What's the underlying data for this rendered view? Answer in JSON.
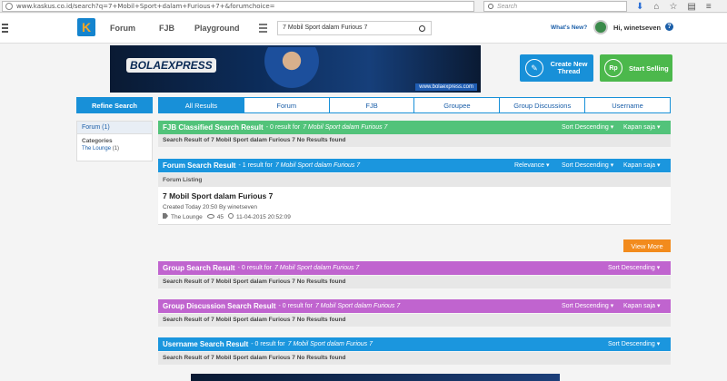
{
  "browser": {
    "url": "www.kaskus.co.id/search?q=7+Mobil+Sport+dalam+Furious+7+&forumchoice=",
    "search_placeholder": "Search"
  },
  "header": {
    "logo_text": "K",
    "nav": [
      "Forum",
      "FJB",
      "Playground"
    ],
    "search_value": "7 Mobil Sport dalam Furious 7",
    "whats_new": "What's New?",
    "greeting": "Hi, winetseven",
    "help": "?"
  },
  "banner": {
    "logo_text": "BOLAEXPRESS",
    "url_text": "www.bolaexpress.com"
  },
  "actions": {
    "create_thread": "Create New Thread",
    "start_selling": "Start Selling",
    "rp": "Rp"
  },
  "sidebar": {
    "refine_label": "Refine Search",
    "forum_count": "Forum (1)",
    "categories_title": "Categories",
    "category_item": "The Lounge",
    "category_count": "(1)"
  },
  "tabs": [
    "All Results",
    "Forum",
    "FJB",
    "Groupee",
    "Group Discussions",
    "Username"
  ],
  "query": "7 Mobil Sport dalam Furious 7",
  "sections": {
    "fjb": {
      "title": "FJB Classified Search Result",
      "count": "- 0 result for",
      "sort": "Sort Descending",
      "time": "Kapan saja",
      "empty": "Search Result of 7 Mobil Sport dalam Furious 7 No Results found"
    },
    "forum": {
      "title": "Forum Search Result",
      "count": "- 1 result for",
      "relevance": "Relevance",
      "sort": "Sort Descending",
      "time": "Kapan saja",
      "listing_label": "Forum Listing",
      "result_title": "7 Mobil Sport dalam Furious 7",
      "created": "Created Today 20:50 By winetseven",
      "category": "The Lounge",
      "views": "45",
      "date": "11-04-2015 20:52:09"
    },
    "view_more": "View More",
    "group": {
      "title": "Group Search Result",
      "count": "- 0 result for",
      "sort": "Sort Descending",
      "empty": "Search Result of 7 Mobil Sport dalam Furious 7 No Results found"
    },
    "group_discussion": {
      "title": "Group Discussion Search Result",
      "count": "- 0 result for",
      "sort": "Sort Descending",
      "time": "Kapan saja",
      "empty": "Search Result of 7 Mobil Sport dalam Furious 7 No Results found"
    },
    "username": {
      "title": "Username Search Result",
      "count": "- 0 result for",
      "sort": "Sort Descending",
      "empty": "Search Result of 7 Mobil Sport dalam Furious 7 No Results found"
    }
  },
  "colors": {
    "primary_blue": "#1890d8",
    "fjb_green": "#52c37a",
    "group_purple": "#c064cf",
    "view_more_orange": "#f28b1d"
  }
}
